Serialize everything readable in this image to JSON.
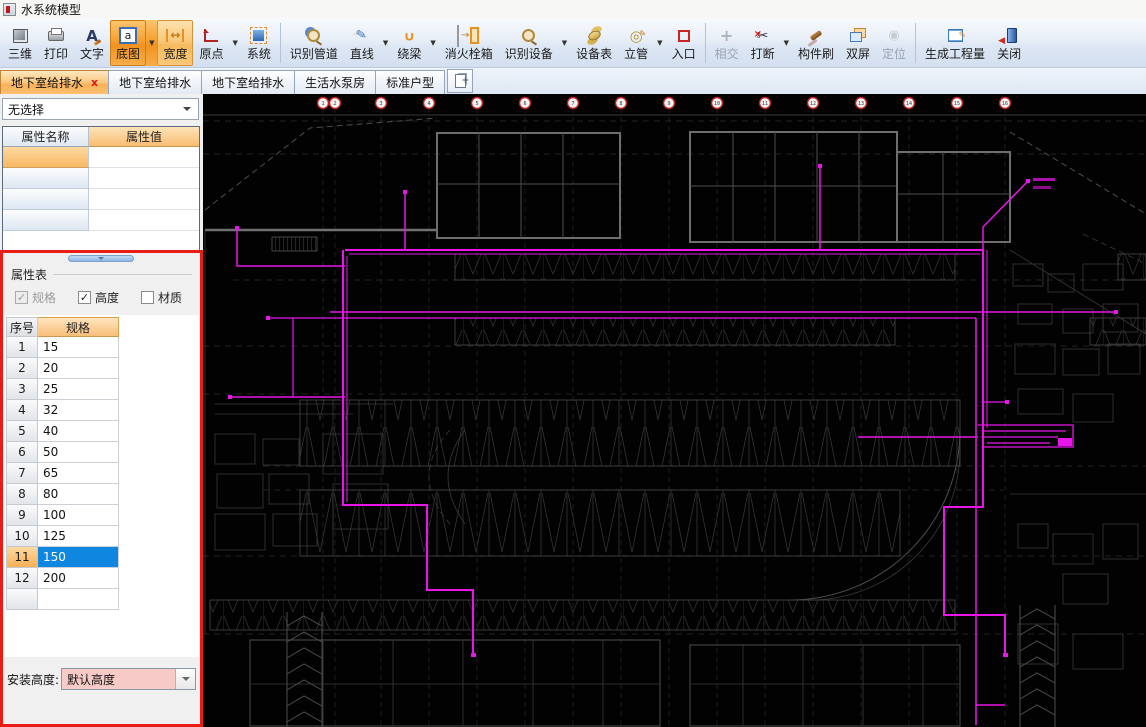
{
  "window": {
    "title": "水系统模型"
  },
  "toolbar": {
    "items": [
      {
        "name": "3d-view-button",
        "label": "三维",
        "icon": "cube-3d-icon"
      },
      {
        "name": "print-button",
        "label": "打印",
        "icon": "printer-icon"
      },
      {
        "name": "text-button",
        "label": "文字",
        "icon": "text-icon"
      },
      {
        "name": "basemap-button",
        "label": "底图",
        "icon": "basemap-icon",
        "state": "active",
        "dropdown": true
      },
      {
        "name": "width-button",
        "label": "宽度",
        "icon": "width-icon",
        "state": "active2"
      },
      {
        "name": "origin-button",
        "label": "原点",
        "icon": "origin-icon",
        "dropdown": true
      },
      {
        "name": "system-button",
        "label": "系统",
        "icon": "system-icon"
      },
      {
        "sep": true
      },
      {
        "name": "identify-pipe-button",
        "label": "识别管道",
        "icon": "identify-pipe-icon"
      },
      {
        "name": "line-button",
        "label": "直线",
        "icon": "line-icon",
        "dropdown": true
      },
      {
        "name": "around-beam-button",
        "label": "绕梁",
        "icon": "around-beam-icon",
        "dropdown": true
      },
      {
        "name": "hydrant-box-button",
        "label": "消火栓箱",
        "icon": "hydrant-box-icon"
      },
      {
        "name": "identify-device-button",
        "label": "识别设备",
        "icon": "identify-device-icon",
        "dropdown": true
      },
      {
        "name": "device-table-button",
        "label": "设备表",
        "icon": "device-table-icon"
      },
      {
        "name": "riser-button",
        "label": "立管",
        "icon": "riser-icon",
        "dropdown": true
      },
      {
        "name": "entrance-button",
        "label": "入口",
        "icon": "entrance-icon"
      },
      {
        "sep": true
      },
      {
        "name": "intersect-button",
        "label": "相交",
        "icon": "intersect-icon",
        "state": "disabled"
      },
      {
        "name": "break-button",
        "label": "打断",
        "icon": "break-icon",
        "dropdown": true
      },
      {
        "name": "component-brush-button",
        "label": "构件刷",
        "icon": "brush-icon"
      },
      {
        "name": "dual-screen-button",
        "label": "双屏",
        "icon": "dual-screen-icon"
      },
      {
        "name": "locate-button",
        "label": "定位",
        "icon": "locate-icon",
        "state": "disabled"
      },
      {
        "sep": true
      },
      {
        "name": "generate-quantity-button",
        "label": "生成工程量",
        "icon": "quantity-icon"
      },
      {
        "name": "close-button",
        "label": "关闭",
        "icon": "close-icon"
      }
    ]
  },
  "tabs": {
    "items": [
      {
        "label": "地下室给排水",
        "active": true,
        "closable": true,
        "close_label": "x"
      },
      {
        "label": "地下室给排水"
      },
      {
        "label": "地下室给排水"
      },
      {
        "label": "生活水泵房"
      },
      {
        "label": "标准户型"
      }
    ]
  },
  "sidebar": {
    "selector_value": "无选择",
    "property_grid": {
      "col1": "属性名称",
      "col2": "属性值",
      "rows": [
        [
          "",
          ""
        ],
        [
          "",
          ""
        ],
        [
          "",
          ""
        ],
        [
          "",
          ""
        ]
      ]
    },
    "group_title": "属性表",
    "checkboxes": [
      {
        "label": "规格",
        "checked": true,
        "disabled": true
      },
      {
        "label": "高度",
        "checked": true,
        "disabled": false
      },
      {
        "label": "材质",
        "checked": false,
        "disabled": false
      }
    ],
    "spec_table": {
      "col_no": "序号",
      "col_spec": "规格",
      "rows": [
        {
          "no": "1",
          "spec": "15"
        },
        {
          "no": "2",
          "spec": "20"
        },
        {
          "no": "3",
          "spec": "25"
        },
        {
          "no": "4",
          "spec": "32"
        },
        {
          "no": "5",
          "spec": "40"
        },
        {
          "no": "6",
          "spec": "50"
        },
        {
          "no": "7",
          "spec": "65"
        },
        {
          "no": "8",
          "spec": "80"
        },
        {
          "no": "9",
          "spec": "100"
        },
        {
          "no": "10",
          "spec": "125"
        },
        {
          "no": "11",
          "spec": "150",
          "selected": true
        },
        {
          "no": "12",
          "spec": "200"
        },
        {
          "no": "",
          "spec": ""
        }
      ]
    },
    "install_height_label": "安装高度:",
    "install_height_value": "默认高度"
  },
  "drawing": {
    "axis_bubbles": 16,
    "colors": {
      "pipe_magenta": "#e816e8",
      "grid_bubble_red": "#c41e1e",
      "panel_border_red": "#ea1c16",
      "accent_orange": "#f6a030",
      "selection_blue": "#0f86e0",
      "combo_pink": "#f6cbc7",
      "background": "#020202"
    }
  }
}
